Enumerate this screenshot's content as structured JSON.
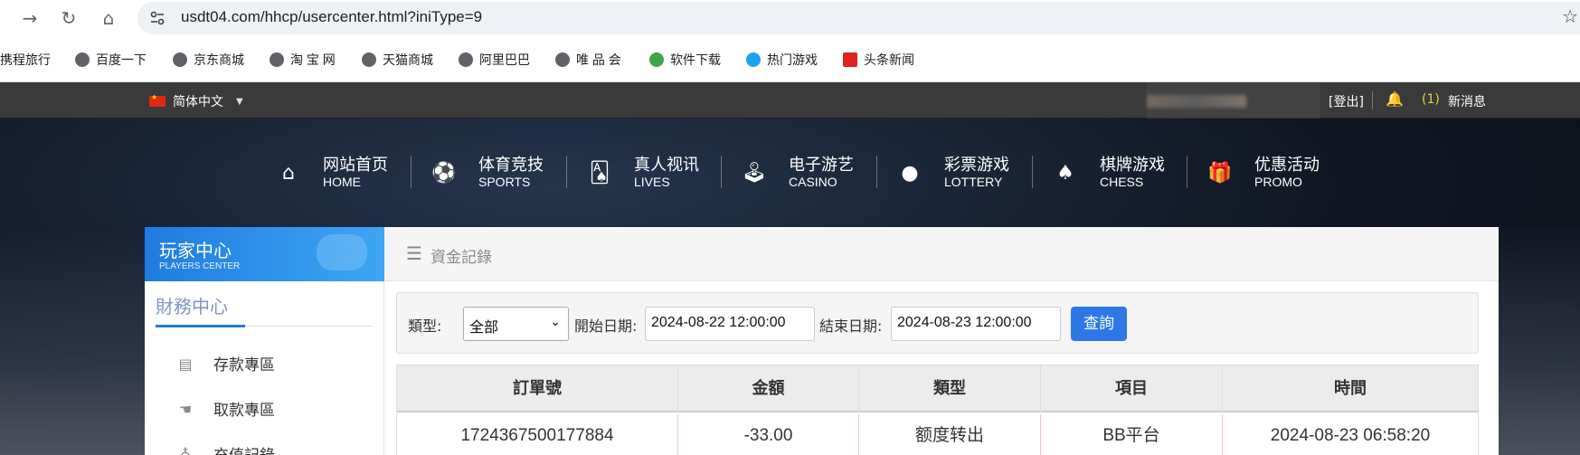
{
  "browser": {
    "url": "usdt04.com/hhcp/usercenter.html?iniType=9",
    "bookmarks": [
      {
        "label": "携程旅行",
        "icon": "none"
      },
      {
        "label": "百度一下",
        "icon": "globe-icon"
      },
      {
        "label": "京东商城",
        "icon": "globe-icon"
      },
      {
        "label": "淘 宝 网",
        "icon": "globe-icon"
      },
      {
        "label": "天猫商城",
        "icon": "globe-icon"
      },
      {
        "label": "阿里巴巴",
        "icon": "globe-icon"
      },
      {
        "label": "唯 品 会",
        "icon": "globe-icon"
      },
      {
        "label": "软件下载",
        "icon": "download-app-icon"
      },
      {
        "label": "热门游戏",
        "icon": "game-mascot-icon"
      },
      {
        "label": "头条新闻",
        "icon": "toutiao-icon"
      }
    ]
  },
  "topbar": {
    "language": "简体中文",
    "logout": "[登出]",
    "message_count": "(1)",
    "message_label": "新消息"
  },
  "menu": [
    {
      "zh": "网站首页",
      "en": "HOME",
      "icon": "house-icon"
    },
    {
      "zh": "体育竞技",
      "en": "SPORTS",
      "icon": "ball-icon"
    },
    {
      "zh": "真人视讯",
      "en": "LIVES",
      "icon": "cards-icon"
    },
    {
      "zh": "电子游艺",
      "en": "CASINO",
      "icon": "joystick-icon"
    },
    {
      "zh": "彩票游戏",
      "en": "LOTTERY",
      "icon": "lottery-balls-icon"
    },
    {
      "zh": "棋牌游戏",
      "en": "CHESS",
      "icon": "spade-icon"
    },
    {
      "zh": "优惠活动",
      "en": "PROMO",
      "icon": "gift-icon"
    }
  ],
  "sidebar": {
    "title": "玩家中心",
    "subtitle": "PLAYERS CENTER",
    "section": "財務中心",
    "items": [
      {
        "label": "存款專區",
        "icon": "wallet-icon"
      },
      {
        "label": "取款專區",
        "icon": "hand-cash-icon"
      },
      {
        "label": "充值記錄",
        "icon": "moneybag-icon"
      }
    ]
  },
  "main": {
    "title": "資金記錄",
    "filter": {
      "type_label": "類型:",
      "type_value": "全部",
      "start_label": "開始日期:",
      "start_value": "2024-08-22 12:00:00",
      "end_label": "結束日期:",
      "end_value": "2024-08-23 12:00:00",
      "search_button": "查詢"
    },
    "table": {
      "headers": [
        "訂單號",
        "金額",
        "類型",
        "項目",
        "時間"
      ],
      "rows": [
        [
          "1724367500177884",
          "-33.00",
          "额度转出",
          "BB平台",
          "2024-08-23 06:58:20"
        ]
      ]
    }
  },
  "colors": {
    "accent": "#2d78e6",
    "message_count": "#e7d13a",
    "sidebar_head": "#1f7ce0"
  }
}
